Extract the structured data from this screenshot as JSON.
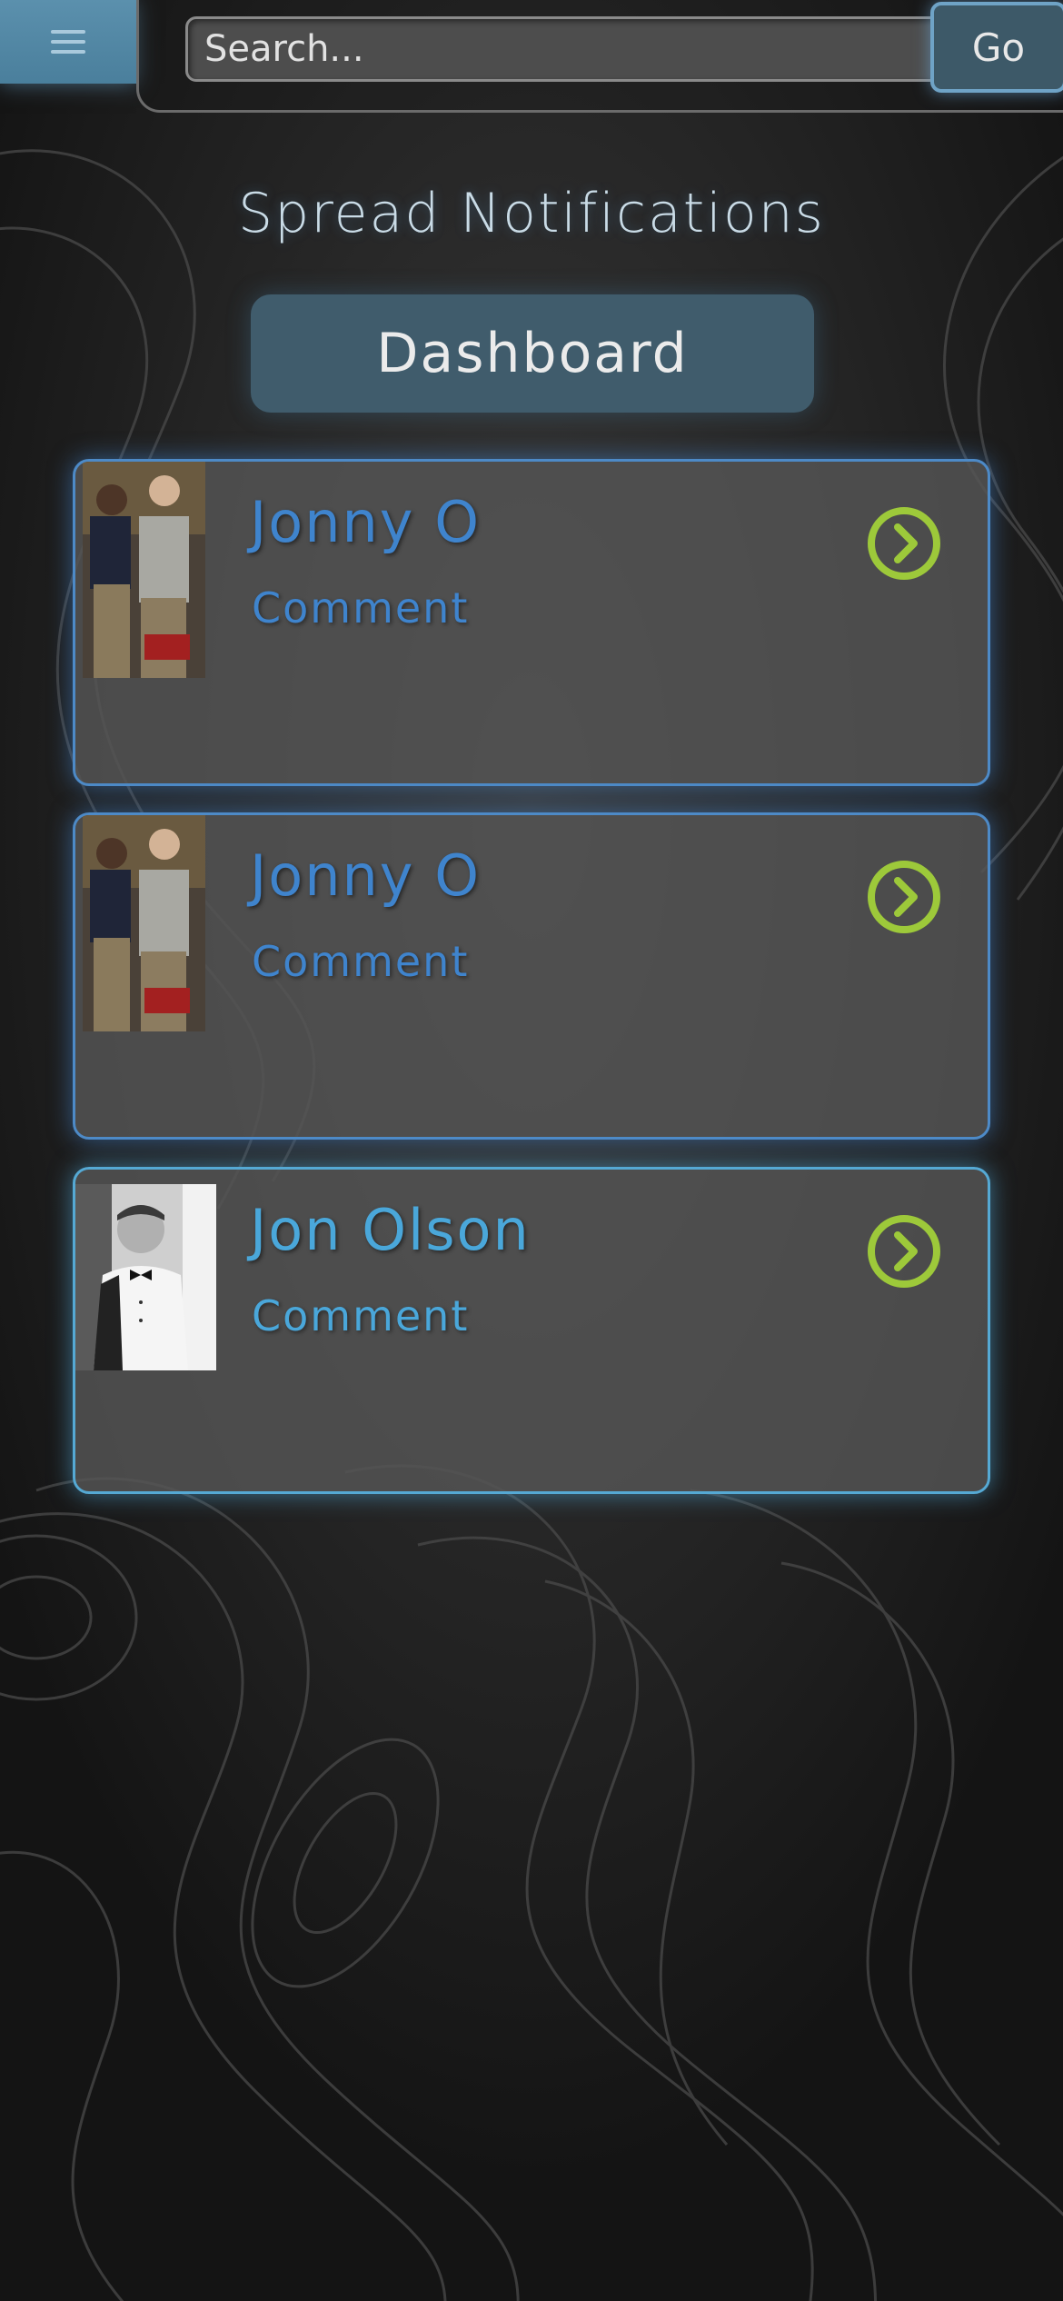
{
  "header": {
    "menu_icon": "hamburger-icon",
    "search_placeholder": "Search...",
    "go_label": "Go"
  },
  "page": {
    "title": "Spread Notifications",
    "dashboard_label": "Dashboard"
  },
  "notifications": [
    {
      "name": "Jonny O",
      "comment": "Comment",
      "avatar": "photo-two-people",
      "icon": "chevron-right-circle-icon"
    },
    {
      "name": "Jonny O",
      "comment": "Comment",
      "avatar": "photo-two-people",
      "icon": "chevron-right-circle-icon"
    },
    {
      "name": "Jon Olson",
      "comment": "Comment",
      "avatar": "photo-man-bowtie",
      "icon": "chevron-right-circle-icon"
    }
  ],
  "colors": {
    "accent_blue": "#4d8ac7",
    "arrow_green": "#9dc93a",
    "menu_blue": "#5b90ad"
  }
}
